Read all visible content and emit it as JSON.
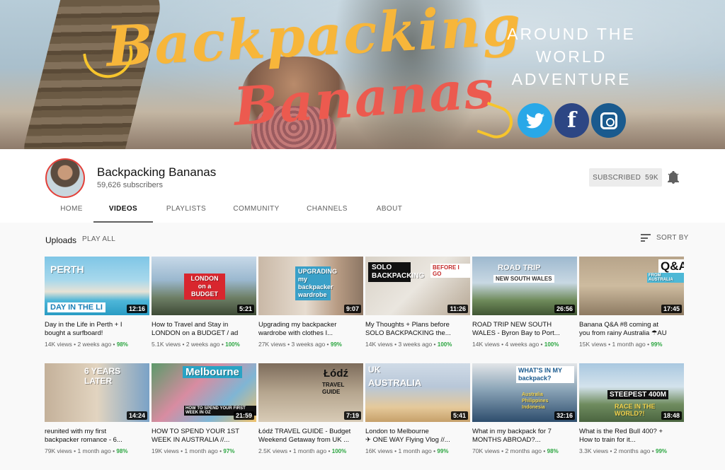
{
  "banner": {
    "script_line1": "Backpacking",
    "script_line2": "Bananas",
    "tagline": [
      "AROUND THE",
      "WORLD",
      "ADVENTURE"
    ],
    "social_icons": [
      "twitter-icon",
      "facebook-icon",
      "instagram-icon"
    ]
  },
  "channel": {
    "name": "Backpacking Bananas",
    "subscribers": "59,626 subscribers",
    "subscribe_label": "SUBSCRIBED",
    "subscribe_count": "59K"
  },
  "tabs": [
    "HOME",
    "VIDEOS",
    "PLAYLISTS",
    "COMMUNITY",
    "CHANNELS",
    "ABOUT"
  ],
  "active_tab": "VIDEOS",
  "uploads": {
    "title": "Uploads",
    "play_all": "PLAY ALL",
    "sort_by": "SORT BY"
  },
  "videos": [
    {
      "title_line1": "Day in the Life in Perth + I",
      "title_line2": "bought a surfboard!",
      "duration": "12:16",
      "views": "14K views",
      "age": "2 weeks ago",
      "pct": "98%",
      "overlay": "DAY IN THE LI",
      "overlay2": "PERTH"
    },
    {
      "title_line1": "How to Travel and Stay in",
      "title_line2": "LONDON on a BUDGET / ad",
      "duration": "5:21",
      "views": "5.1K views",
      "age": "2 weeks ago",
      "pct": "100%",
      "overlay": "LONDON on a BUDGET",
      "overlay2": ""
    },
    {
      "title_line1": "Upgrading my backpacker",
      "title_line2": "wardrobe with clothes I...",
      "duration": "9:07",
      "views": "27K views",
      "age": "3 weeks ago",
      "pct": "99%",
      "overlay": "UPGRADING my backpacker wardrobe",
      "overlay2": ""
    },
    {
      "title_line1": "My Thoughts + Plans before",
      "title_line2": "SOLO BACKPACKING the...",
      "duration": "11:26",
      "views": "14K views",
      "age": "3 weeks ago",
      "pct": "100%",
      "overlay": "SOLO BACKPACKING",
      "overlay2": "BEFORE I GO"
    },
    {
      "title_line1": "ROAD TRIP NEW SOUTH",
      "title_line2": "WALES - Byron Bay to Port...",
      "duration": "26:56",
      "views": "14K views",
      "age": "4 weeks ago",
      "pct": "100%",
      "overlay": "ROAD TRIP",
      "overlay2": "NEW SOUTH WALES"
    },
    {
      "title_line1": "Banana Q&A #8 coming at",
      "title_line2": "you from rainy Australia ☂AU",
      "duration": "17:45",
      "views": "15K views",
      "age": "1 month ago",
      "pct": "99%",
      "overlay": "Q&A",
      "overlay2": "FROM AUSTRALIA"
    },
    {
      "title_line1": "reunited with my first",
      "title_line2": "backpacker romance - 6...",
      "duration": "14:24",
      "views": "79K views",
      "age": "1 month ago",
      "pct": "98%",
      "overlay": "6 YEARS LATER",
      "overlay2": ""
    },
    {
      "title_line1": "HOW TO SPEND YOUR 1ST",
      "title_line2": "WEEK IN AUSTRALIA //...",
      "duration": "21:59",
      "views": "19K views",
      "age": "1 month ago",
      "pct": "97%",
      "overlay": "Melbourne",
      "overlay2": "HOW TO SPEND YOUR FIRST WEEK IN OZ"
    },
    {
      "title_line1": "Łódź TRAVEL GUIDE - Budget",
      "title_line2": "Weekend Getaway from UK ...",
      "duration": "7:19",
      "views": "2.5K views",
      "age": "1 month ago",
      "pct": "100%",
      "overlay": "Łódź",
      "overlay2": "TRAVEL GUIDE"
    },
    {
      "title_line1": "London to Melbourne",
      "title_line2": "✈ ONE WAY Flying Vlog //...",
      "duration": "5:41",
      "views": "16K views",
      "age": "1 month ago",
      "pct": "99%",
      "overlay": "UK",
      "overlay2": "AUSTRALIA"
    },
    {
      "title_line1": "What in my backpack for 7",
      "title_line2": "MONTHS ABROAD?...",
      "duration": "32:16",
      "views": "70K views",
      "age": "2 months ago",
      "pct": "98%",
      "overlay": "WHAT'S IN MY backpack?",
      "overlay2": "Australia Philippines Indonesia"
    },
    {
      "title_line1": "What is the Red Bull 400? +",
      "title_line2": "How to train for it...",
      "duration": "18:48",
      "views": "3.3K views",
      "age": "2 months ago",
      "pct": "99%",
      "overlay": "STEEPEST 400M",
      "overlay2": "RACE IN THE WORLD?!"
    }
  ],
  "colors": {
    "subscribed_bg": "#ececec",
    "percent_green": "#2ba640",
    "banner_orange": "#f7b63a",
    "banner_coral": "#ec5a4f",
    "twitter": "#29a8e8",
    "facebook": "#2d4684",
    "instagram": "#1a5a8e"
  }
}
